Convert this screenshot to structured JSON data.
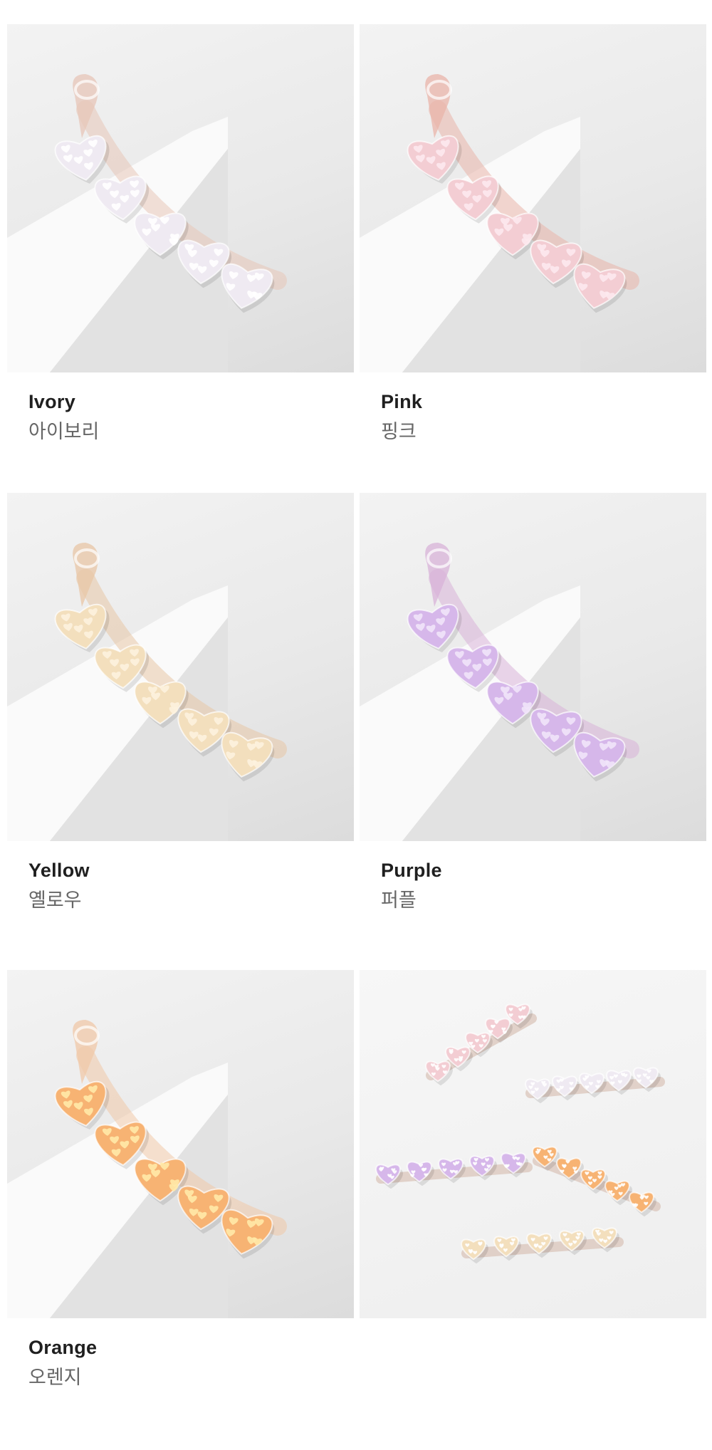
{
  "products": [
    {
      "en": "Ivory",
      "ko": "아이보리",
      "colors": {
        "heart": "#efeaf2",
        "glitter": "#ffffff",
        "clip": "#e7c6b8"
      }
    },
    {
      "en": "Pink",
      "ko": "핑크",
      "colors": {
        "heart": "#f3cdd3",
        "glitter": "#fde9ee",
        "clip": "#eab4aa"
      }
    },
    {
      "en": "Yellow",
      "ko": "옐로우",
      "colors": {
        "heart": "#f3dfbd",
        "glitter": "#fdf2de",
        "clip": "#e8c6a5"
      }
    },
    {
      "en": "Purple",
      "ko": "퍼플",
      "colors": {
        "heart": "#d6b7ea",
        "glitter": "#f1e4fa",
        "clip": "#d8b3d8"
      }
    },
    {
      "en": "Orange",
      "ko": "오렌지",
      "colors": {
        "heart": "#f7b373",
        "glitter": "#ffe9a8",
        "clip": "#f0c8a8"
      }
    }
  ],
  "group_photo": {
    "colors": [
      "#f3cdd3",
      "#efeaf2",
      "#f7b373",
      "#d6b7ea",
      "#f3dfbd"
    ]
  }
}
